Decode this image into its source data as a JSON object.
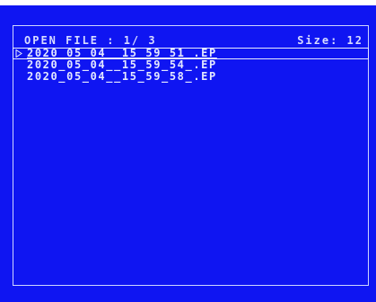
{
  "header": {
    "title": "OPEN FILE : 1/ 3",
    "size": "Size: 12"
  },
  "files": [
    {
      "name": "2020_05_04__15_59_51_.EP",
      "selected": true
    },
    {
      "name": "2020_05_04__15_59_54_.EP",
      "selected": false
    },
    {
      "name": "2020_05_04__15_59_58_.EP",
      "selected": false
    }
  ],
  "cursor_icon": "play-triangle-outline",
  "colors": {
    "background": "#0f15f2",
    "text": "#e4e8ff"
  }
}
